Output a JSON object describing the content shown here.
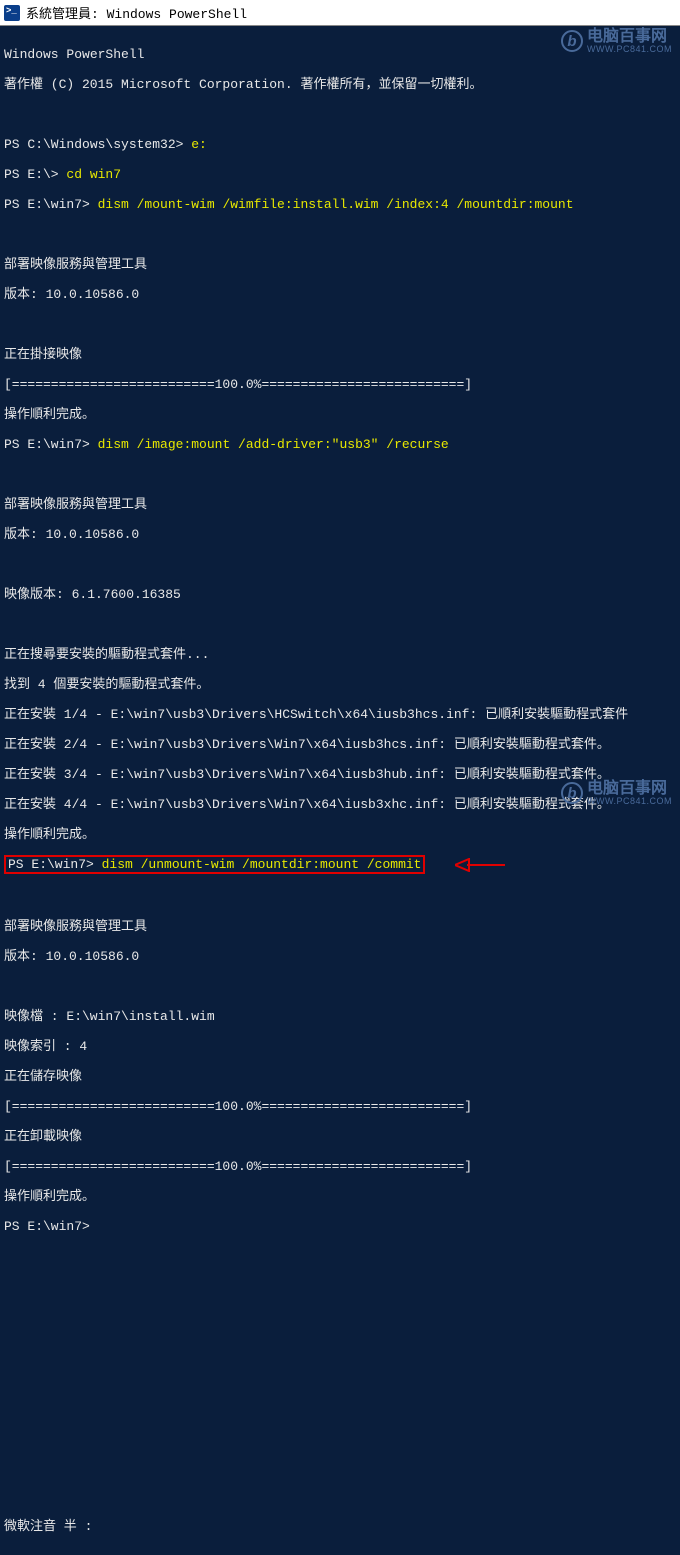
{
  "window": {
    "title": "系統管理員: Windows PowerShell"
  },
  "watermark": {
    "name": "电脑百事网",
    "url": "WWW.PC841.COM",
    "icon_letter": "b"
  },
  "lines": {
    "l01": "Windows PowerShell",
    "l02": "著作權 (C) 2015 Microsoft Corporation. 著作權所有，並保留一切權利。",
    "l03": " ",
    "l04_p": "PS C:\\Windows\\system32> ",
    "l04_c": "e:",
    "l05_p": "PS E:\\> ",
    "l05_c": "cd win7",
    "l06_p": "PS E:\\win7> ",
    "l06_c": "dism /mount-wim /wimfile:install.wim /index:4 /mountdir:mount",
    "l07": " ",
    "l08": "部署映像服務與管理工具",
    "l09": "版本: 10.0.10586.0",
    "l10": " ",
    "l11": "正在掛接映像",
    "l12": "[==========================100.0%==========================]",
    "l13": "操作順利完成。",
    "l14_p": "PS E:\\win7> ",
    "l14_c": "dism /image:mount /add-driver:\"usb3\" /recurse",
    "l15": " ",
    "l16": "部署映像服務與管理工具",
    "l17": "版本: 10.0.10586.0",
    "l18": " ",
    "l19": "映像版本: 6.1.7600.16385",
    "l20": " ",
    "l21": "正在搜尋要安裝的驅動程式套件...",
    "l22": "找到 4 個要安裝的驅動程式套件。",
    "l23": "正在安裝 1/4 - E:\\win7\\usb3\\Drivers\\HCSwitch\\x64\\iusb3hcs.inf: 已順利安裝驅動程式套件",
    "l24": "正在安裝 2/4 - E:\\win7\\usb3\\Drivers\\Win7\\x64\\iusb3hcs.inf: 已順利安裝驅動程式套件。",
    "l25": "正在安裝 3/4 - E:\\win7\\usb3\\Drivers\\Win7\\x64\\iusb3hub.inf: 已順利安裝驅動程式套件。",
    "l26": "正在安裝 4/4 - E:\\win7\\usb3\\Drivers\\Win7\\x64\\iusb3xhc.inf: 已順利安裝驅動程式套件。",
    "l27": "操作順利完成。",
    "l28_p": "PS E:\\win7> ",
    "l28_c": "dism /unmount-wim /mountdir:mount /commit",
    "l29": " ",
    "l30": "部署映像服務與管理工具",
    "l31": "版本: 10.0.10586.0",
    "l32": " ",
    "l33": "映像檔 : E:\\win7\\install.wim",
    "l34": "映像索引 : 4",
    "l35": "正在儲存映像",
    "l36": "[==========================100.0%==========================]",
    "l37": "正在卸載映像",
    "l38": "[==========================100.0%==========================]",
    "l39": "操作順利完成。",
    "l40": "PS E:\\win7>",
    "l99": "微軟注音 半 :"
  }
}
